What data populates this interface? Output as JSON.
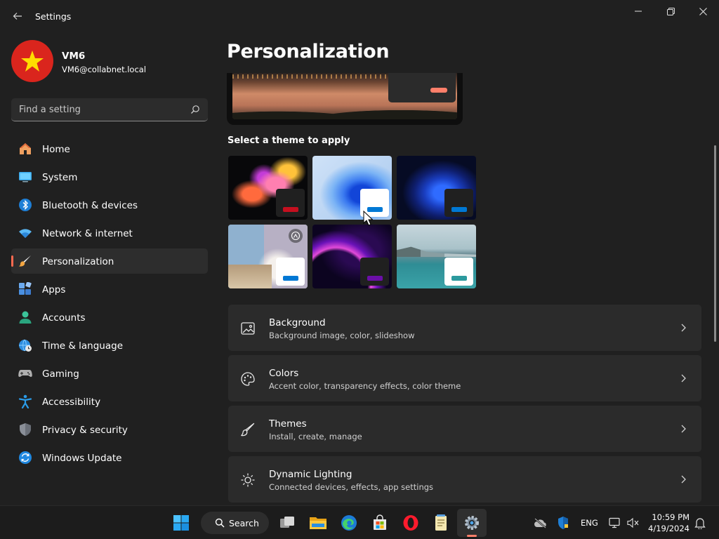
{
  "window": {
    "title": "Settings",
    "back_icon": "back-arrow-icon",
    "controls": [
      "minimize-icon",
      "restore-icon",
      "close-icon"
    ]
  },
  "profile": {
    "name": "VM6",
    "email": "VM6@collabnet.local",
    "avatar_icon": "vietnam-flag-avatar-icon",
    "avatar_color": "#da251d"
  },
  "search": {
    "placeholder": "Find a setting",
    "value": ""
  },
  "sidebar": {
    "selected": "Personalization",
    "accent_color": "#ff6a50",
    "items": [
      {
        "label": "Home",
        "icon": "home-icon"
      },
      {
        "label": "System",
        "icon": "monitor-icon"
      },
      {
        "label": "Bluetooth & devices",
        "icon": "bluetooth-icon"
      },
      {
        "label": "Network & internet",
        "icon": "wifi-icon"
      },
      {
        "label": "Personalization",
        "icon": "paintbrush-icon"
      },
      {
        "label": "Apps",
        "icon": "apps-grid-icon"
      },
      {
        "label": "Accounts",
        "icon": "person-icon"
      },
      {
        "label": "Time & language",
        "icon": "globe-clock-icon"
      },
      {
        "label": "Gaming",
        "icon": "gamepad-icon"
      },
      {
        "label": "Accessibility",
        "icon": "accessibility-icon"
      },
      {
        "label": "Privacy & security",
        "icon": "shield-icon"
      },
      {
        "label": "Windows Update",
        "icon": "update-icon"
      }
    ]
  },
  "main": {
    "page_title": "Personalization",
    "themes_heading": "Select a theme to apply",
    "themes": [
      {
        "name": "flower",
        "accent": "#c50f1f"
      },
      {
        "name": "windows-light",
        "accent": "#0078d4"
      },
      {
        "name": "windows-dark",
        "accent": "#0078d4"
      },
      {
        "name": "blossom",
        "accent": "#0078d4"
      },
      {
        "name": "glow",
        "accent": "#6b0fa8"
      },
      {
        "name": "lake",
        "accent": "#2c9a9e"
      }
    ],
    "cards": [
      {
        "title": "Background",
        "subtitle": "Background image, color, slideshow",
        "icon": "image-icon"
      },
      {
        "title": "Colors",
        "subtitle": "Accent color, transparency effects, color theme",
        "icon": "palette-icon"
      },
      {
        "title": "Themes",
        "subtitle": "Install, create, manage",
        "icon": "brush-icon"
      },
      {
        "title": "Dynamic Lighting",
        "subtitle": "Connected devices, effects, app settings",
        "icon": "sun-icon"
      }
    ]
  },
  "taskbar": {
    "search_label": "Search",
    "pinned": [
      "windows-start-icon",
      "task-view-icon",
      "file-explorer-icon",
      "edge-icon",
      "store-icon",
      "opera-icon",
      "notepad-icon",
      "settings-gear-icon"
    ],
    "tray": {
      "language": "ENG",
      "time": "10:59 PM",
      "date": "4/19/2024"
    }
  }
}
